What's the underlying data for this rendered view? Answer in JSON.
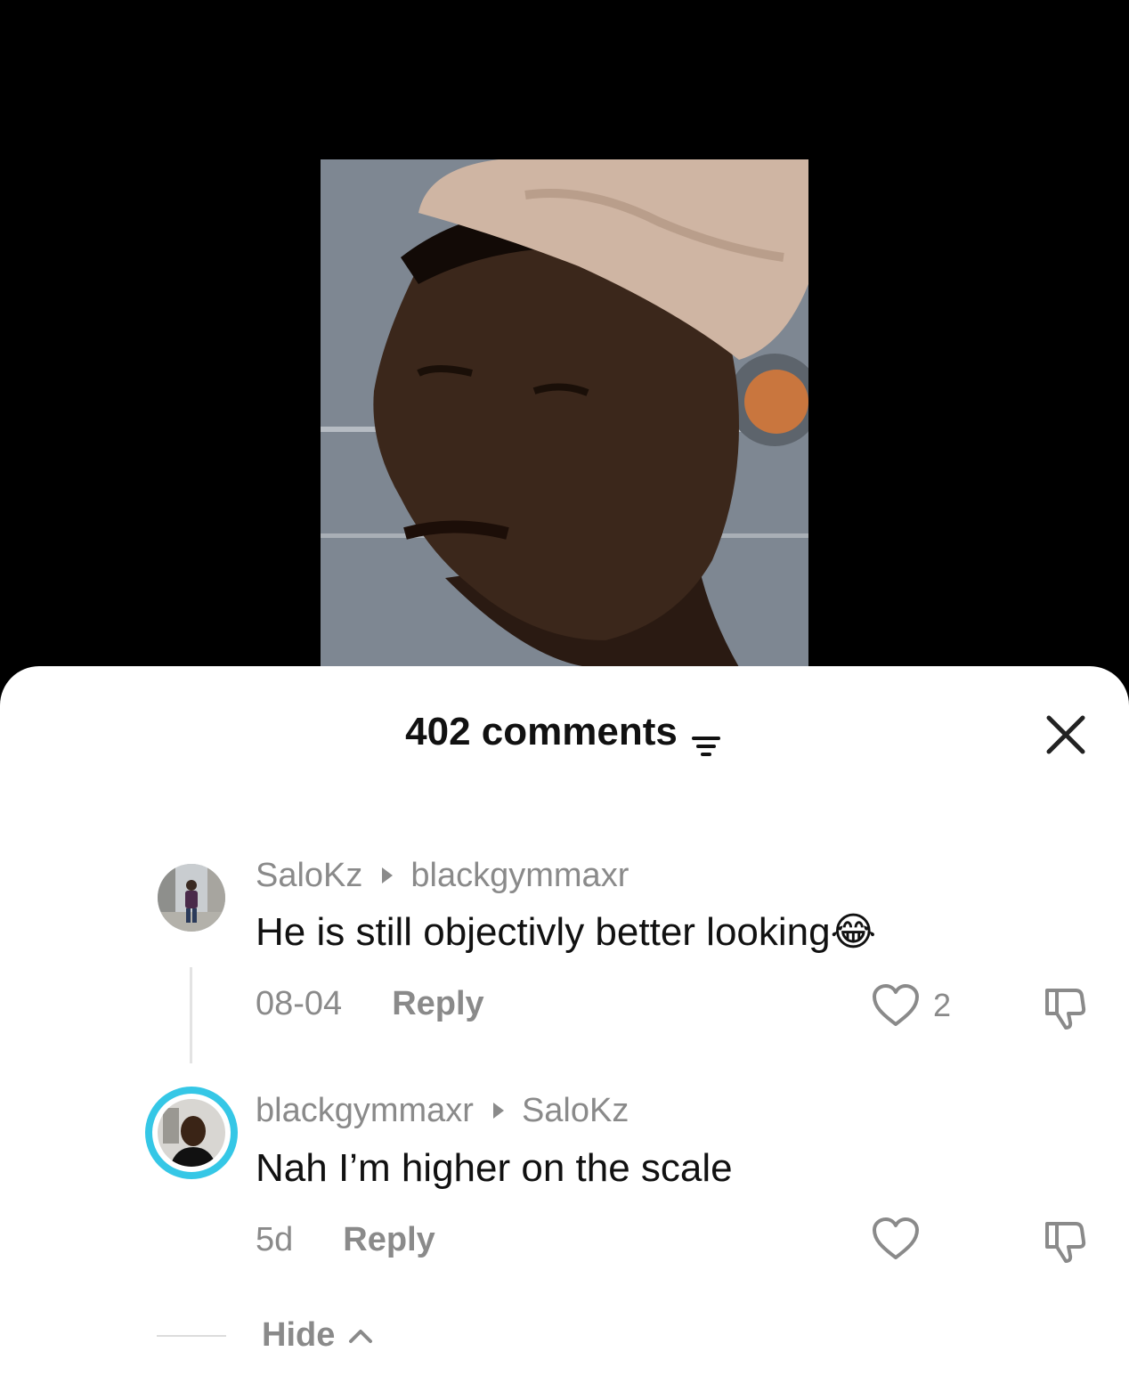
{
  "video": {
    "thumbnail": "portrait-man-white-cap"
  },
  "header": {
    "title": "402 comments",
    "filter_icon": "filter-icon",
    "close_icon": "close-icon"
  },
  "comments": [
    {
      "author": "SaloKz",
      "reply_to": "blackgymmaxr",
      "text": "He is still objectivly better looking",
      "emoji": "😂",
      "date": "08-04",
      "reply_label": "Reply",
      "likes": "2"
    },
    {
      "author": "blackgymmaxr",
      "reply_to": "SaloKz",
      "text": "Nah I’m higher on the scale",
      "date": "5d",
      "reply_label": "Reply",
      "likes": ""
    }
  ],
  "hide_label": "Hide",
  "colors": {
    "muted": "#8a8a8a",
    "text": "#111111",
    "story_ring": "#35c7e6"
  }
}
